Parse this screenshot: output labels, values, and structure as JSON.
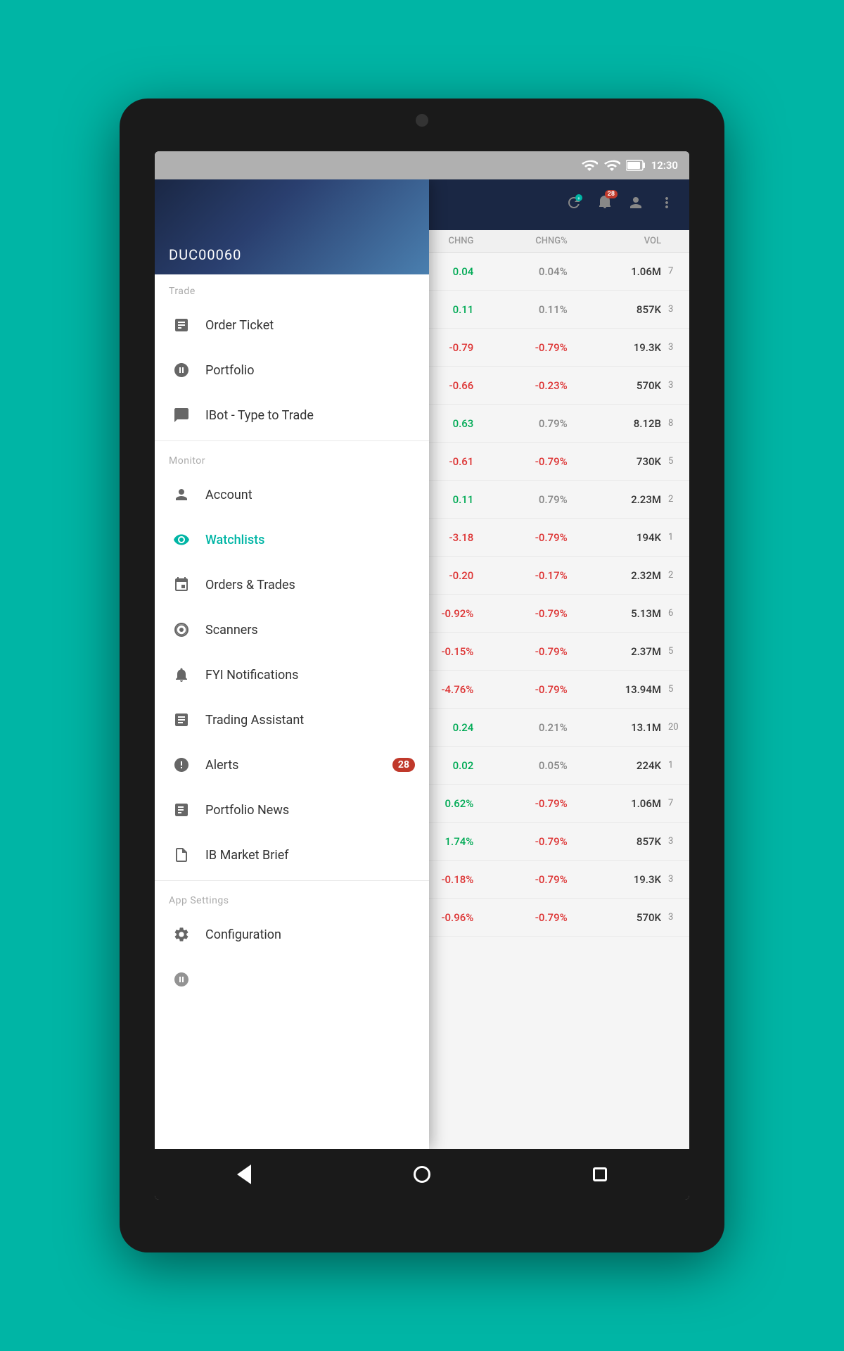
{
  "tablet": {
    "status_bar": {
      "time": "12:30",
      "wifi_icon": "wifi",
      "signal_icon": "signal",
      "battery_icon": "battery"
    },
    "header": {
      "account_id": "DUC00060",
      "notification_badge": "28",
      "columns": [
        "CHNG",
        "CHNG%",
        "VOL"
      ]
    },
    "table_rows": [
      {
        "chng": "0.04",
        "chng_pct": "0.04%",
        "vol": "1.06M",
        "chng_color": "green",
        "pct_color": "grey"
      },
      {
        "chng": "0.11",
        "chng_pct": "0.11%",
        "vol": "857K",
        "chng_color": "green",
        "pct_color": "grey"
      },
      {
        "chng": "-0.79",
        "chng_pct": "-0.79%",
        "vol": "19.3K",
        "chng_color": "red",
        "pct_color": "red"
      },
      {
        "chng": "-0.66",
        "chng_pct": "-0.23%",
        "vol": "570K",
        "chng_color": "red",
        "pct_color": "red"
      },
      {
        "chng": "0.63",
        "chng_pct": "0.79%",
        "vol": "8.12B",
        "chng_color": "green",
        "pct_color": "grey"
      },
      {
        "chng": "-0.61",
        "chng_pct": "-0.79%",
        "vol": "730K",
        "chng_color": "red",
        "pct_color": "red"
      },
      {
        "chng": "0.11",
        "chng_pct": "0.79%",
        "vol": "2.23M",
        "chng_color": "green",
        "pct_color": "grey"
      },
      {
        "chng": "-3.18",
        "chng_pct": "-0.79%",
        "vol": "194K",
        "chng_color": "red",
        "pct_color": "red"
      },
      {
        "chng": "-0.20",
        "chng_pct": "-0.17%",
        "vol": "2.32M",
        "chng_color": "red",
        "pct_color": "red"
      },
      {
        "chng": "-0.92%",
        "chng_pct": "-0.79%",
        "vol": "5.13M",
        "chng_color": "red",
        "pct_color": "red"
      },
      {
        "chng": "-0.15%",
        "chng_pct": "-0.79%",
        "vol": "2.37M",
        "chng_color": "red",
        "pct_color": "red"
      },
      {
        "chng": "-4.76%",
        "chng_pct": "-0.79%",
        "vol": "13.94M",
        "chng_color": "red",
        "pct_color": "red"
      },
      {
        "chng": "0.24",
        "chng_pct": "0.21%",
        "vol": "13.1M",
        "chng_color": "green",
        "pct_color": "grey"
      },
      {
        "chng": "0.02",
        "chng_pct": "0.05%",
        "vol": "224K",
        "chng_color": "green",
        "pct_color": "grey"
      },
      {
        "chng": "0.62%",
        "chng_pct": "-0.79%",
        "vol": "1.06M",
        "chng_color": "green",
        "pct_color": "red"
      },
      {
        "chng": "1.74%",
        "chng_pct": "-0.79%",
        "vol": "857K",
        "chng_color": "green",
        "pct_color": "red"
      },
      {
        "chng": "-0.18%",
        "chng_pct": "-0.79%",
        "vol": "19.3K",
        "chng_color": "red",
        "pct_color": "red"
      },
      {
        "chng": "-0.96%",
        "chng_pct": "-0.79%",
        "vol": "570K",
        "chng_color": "red",
        "pct_color": "red"
      }
    ],
    "drawer": {
      "account_id": "DUC00060",
      "trade_section": "Trade",
      "monitor_section": "Monitor",
      "app_settings_section": "App Settings",
      "items": [
        {
          "id": "order-ticket",
          "label": "Order Ticket",
          "icon": "order-ticket-icon",
          "section": "trade",
          "active": false
        },
        {
          "id": "portfolio",
          "label": "Portfolio",
          "icon": "portfolio-icon",
          "section": "trade",
          "active": false
        },
        {
          "id": "ibot",
          "label": "IBot - Type to Trade",
          "icon": "ibot-icon",
          "section": "trade",
          "active": false
        },
        {
          "id": "account",
          "label": "Account",
          "icon": "account-icon",
          "section": "monitor",
          "active": false
        },
        {
          "id": "watchlists",
          "label": "Watchlists",
          "icon": "watchlist-icon",
          "section": "monitor",
          "active": true
        },
        {
          "id": "orders-trades",
          "label": "Orders & Trades",
          "icon": "orders-icon",
          "section": "monitor",
          "active": false
        },
        {
          "id": "scanners",
          "label": "Scanners",
          "icon": "scanners-icon",
          "section": "monitor",
          "active": false
        },
        {
          "id": "fyi-notifications",
          "label": "FYI Notifications",
          "icon": "fyi-icon",
          "section": "monitor",
          "active": false
        },
        {
          "id": "trading-assistant",
          "label": "Trading Assistant",
          "icon": "trading-assistant-icon",
          "section": "monitor",
          "active": false
        },
        {
          "id": "alerts",
          "label": "Alerts",
          "icon": "alerts-icon",
          "section": "monitor",
          "active": false,
          "badge": "28"
        },
        {
          "id": "portfolio-news",
          "label": "Portfolio News",
          "icon": "portfolio-news-icon",
          "section": "monitor",
          "active": false
        },
        {
          "id": "ib-market-brief",
          "label": "IB Market Brief",
          "icon": "ib-market-icon",
          "section": "monitor",
          "active": false
        },
        {
          "id": "configuration",
          "label": "Configuration",
          "icon": "config-icon",
          "section": "app-settings",
          "active": false
        }
      ]
    },
    "nav": {
      "back": "back",
      "home": "home",
      "recent": "recent"
    }
  }
}
